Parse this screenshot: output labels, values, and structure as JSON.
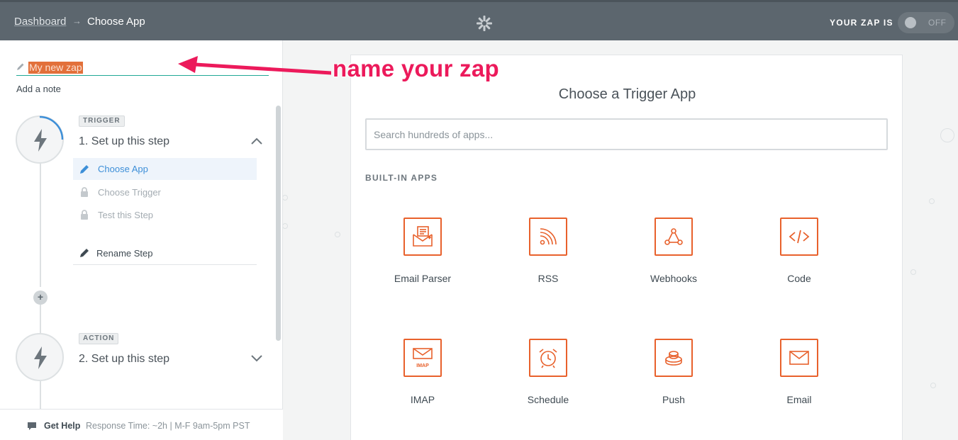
{
  "topbar": {
    "breadcrumb_dashboard": "Dashboard",
    "breadcrumb_arrow": "→",
    "breadcrumb_current": "Choose App",
    "logo_icon": "zapier-gear-icon",
    "zap_status_label": "YOUR ZAP IS",
    "toggle_label": "OFF"
  },
  "editor": {
    "zap_name": "My new zap",
    "add_note": "Add a note"
  },
  "steps": [
    {
      "tag": "TRIGGER",
      "title": "1. Set up this step",
      "expanded": true,
      "substeps": [
        {
          "label": "Choose App",
          "icon": "pencil-icon",
          "active": true
        },
        {
          "label": "Choose Trigger",
          "icon": "lock-icon",
          "active": false
        },
        {
          "label": "Test this Step",
          "icon": "lock-icon",
          "active": false
        }
      ],
      "rename_label": "Rename Step"
    },
    {
      "tag": "ACTION",
      "title": "2. Set up this step",
      "expanded": false
    }
  ],
  "help": {
    "label": "Get Help",
    "response": "Response Time: ~2h | M-F 9am-5pm PST"
  },
  "main": {
    "title": "Choose a Trigger App",
    "search_placeholder": "Search hundreds of apps...",
    "section_label": "BUILT-IN APPS",
    "apps": [
      {
        "name": "Email Parser",
        "icon": "email-parser-icon"
      },
      {
        "name": "RSS",
        "icon": "rss-icon"
      },
      {
        "name": "Webhooks",
        "icon": "webhooks-icon"
      },
      {
        "name": "Code",
        "icon": "code-icon"
      },
      {
        "name": "IMAP",
        "icon": "imap-icon"
      },
      {
        "name": "Schedule",
        "icon": "schedule-icon"
      },
      {
        "name": "Push",
        "icon": "push-icon"
      },
      {
        "name": "Email",
        "icon": "email-icon"
      }
    ]
  },
  "annotation": {
    "text": "name your zap"
  },
  "colors": {
    "topbar": "#5c666e",
    "accent_orange": "#e8612c",
    "annotation_pink": "#ec1a5b",
    "active_blue": "#3d8fd8",
    "underline_teal": "#20a896"
  }
}
